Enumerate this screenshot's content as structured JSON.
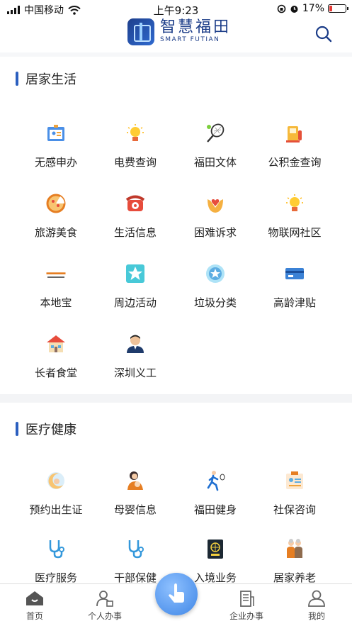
{
  "status": {
    "carrier": "中国移动",
    "time": "上午9:23",
    "battery": "17%",
    "battery_level": 0.17
  },
  "header": {
    "app_name_cn": "智慧福田",
    "app_name_en": "SMART FUTIAN"
  },
  "sections": [
    {
      "title": "居家生活",
      "items": [
        {
          "label": "无感申办",
          "icon": "id-card-icon"
        },
        {
          "label": "电费查询",
          "icon": "lightbulb-icon"
        },
        {
          "label": "福田文体",
          "icon": "tennis-racket-icon"
        },
        {
          "label": "公积金查询",
          "icon": "fuel-pump-icon"
        },
        {
          "label": "旅游美食",
          "icon": "pizza-icon"
        },
        {
          "label": "生活信息",
          "icon": "telephone-icon"
        },
        {
          "label": "困难诉求",
          "icon": "heart-hands-icon"
        },
        {
          "label": "物联网社区",
          "icon": "lightbulb-icon"
        },
        {
          "label": "本地宝",
          "icon": "bendibao-logo-icon"
        },
        {
          "label": "周边活动",
          "icon": "star-box-icon"
        },
        {
          "label": "垃圾分类",
          "icon": "star-circle-icon"
        },
        {
          "label": "高龄津贴",
          "icon": "bank-card-icon"
        },
        {
          "label": "长者食堂",
          "icon": "house-icon"
        },
        {
          "label": "深圳义工",
          "icon": "volunteer-person-icon"
        }
      ]
    },
    {
      "title": "医疗健康",
      "items": [
        {
          "label": "预约出生证",
          "icon": "baby-moon-icon"
        },
        {
          "label": "母婴信息",
          "icon": "mother-baby-icon"
        },
        {
          "label": "福田健身",
          "icon": "runner-icon"
        },
        {
          "label": "社保咨询",
          "icon": "clipboard-icon"
        },
        {
          "label": "医疗服务",
          "icon": "stethoscope-icon"
        },
        {
          "label": "干部保健",
          "icon": "stethoscope-icon"
        },
        {
          "label": "入境业务",
          "icon": "passport-icon"
        },
        {
          "label": "居家养老",
          "icon": "elderly-couple-icon"
        }
      ]
    }
  ],
  "tabbar": {
    "home": "首页",
    "personal": "个人办事",
    "enterprise": "企业办事",
    "mine": "我的"
  }
}
